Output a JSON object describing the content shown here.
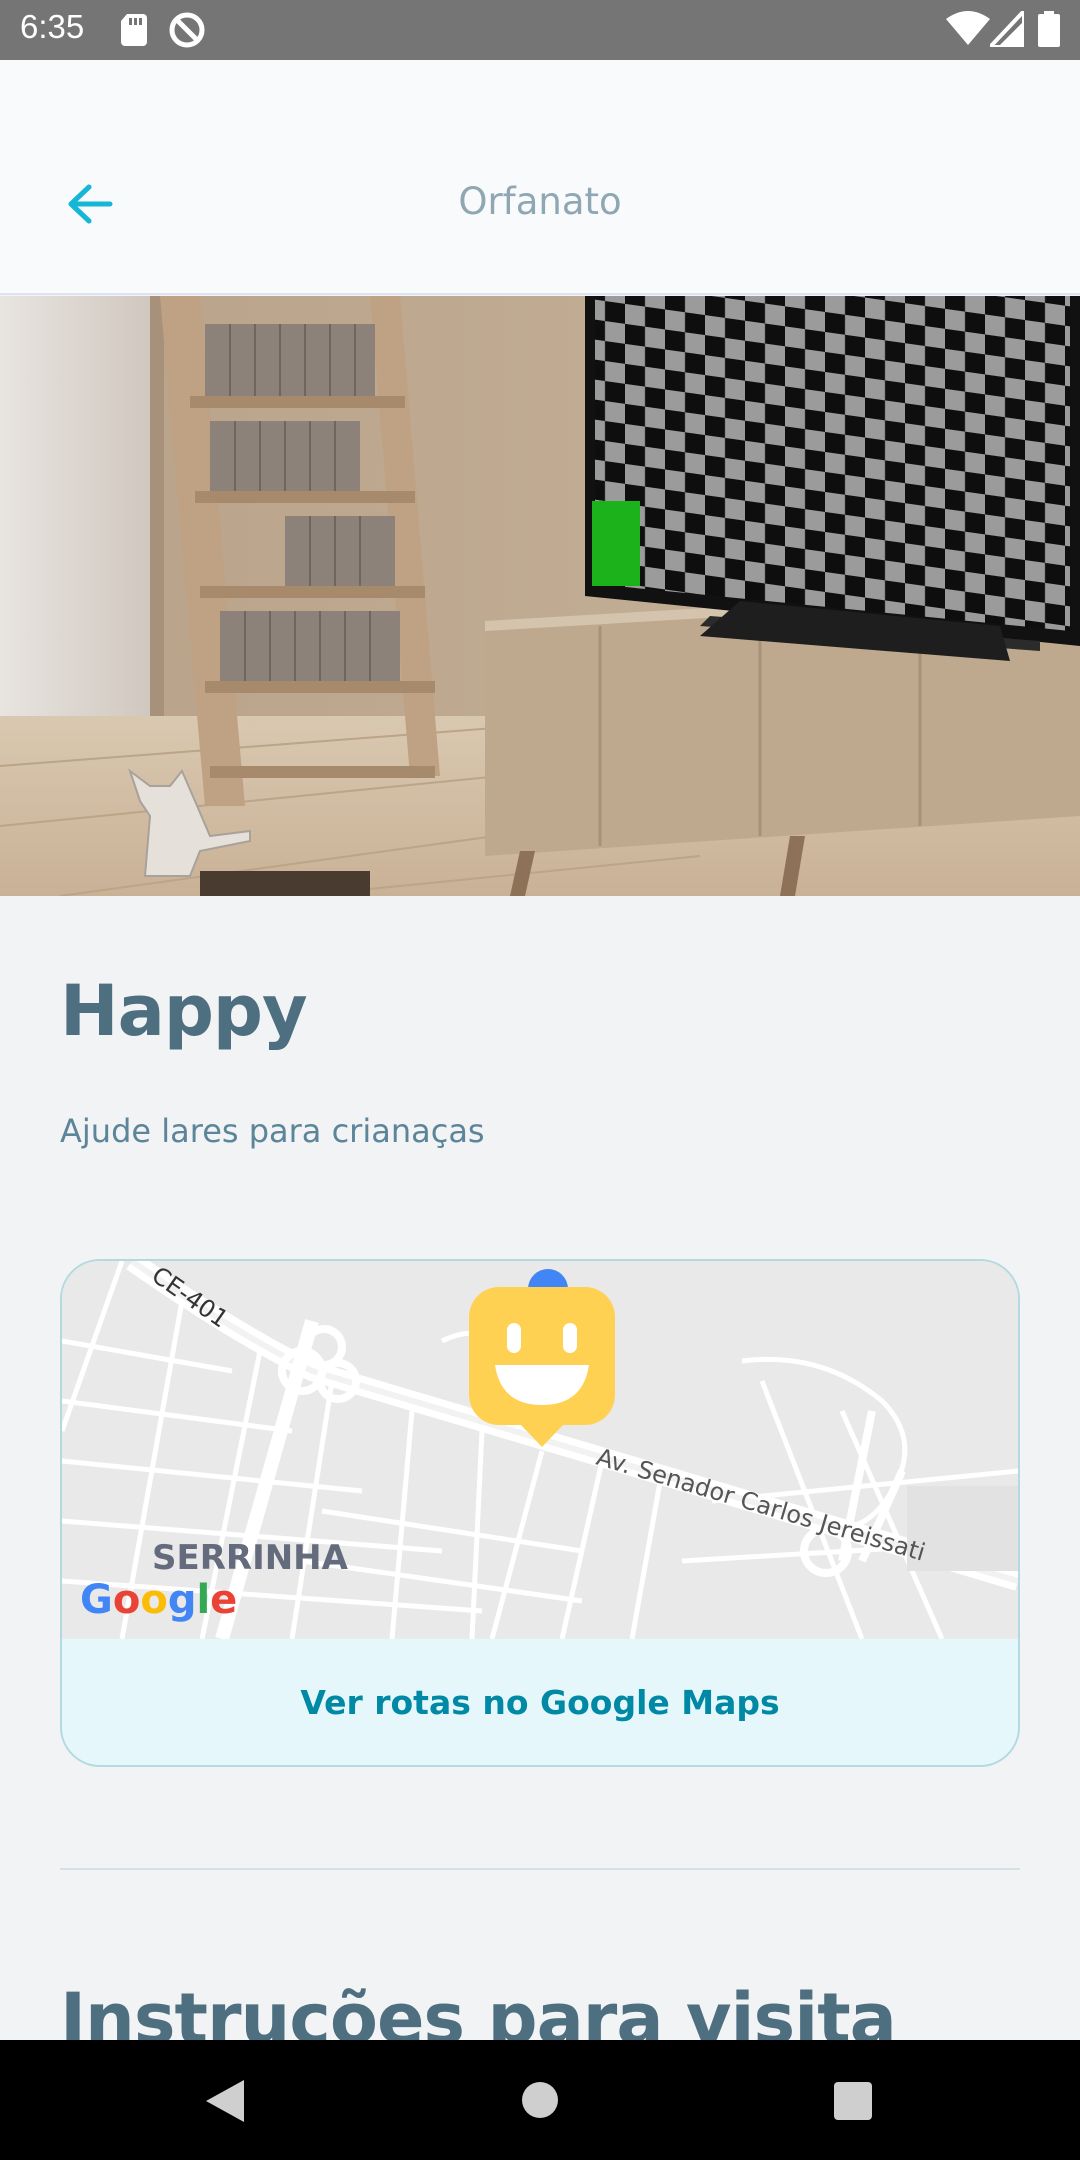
{
  "status_bar": {
    "time": "6:35",
    "icons": [
      "sd-card-icon",
      "do-not-disturb-icon",
      "wifi-icon",
      "cellular-signal-icon",
      "battery-icon"
    ]
  },
  "header": {
    "title": "Orfanato",
    "back_icon": "arrow-left-icon",
    "accent_color": "#15b6d6"
  },
  "hero": {
    "image": "room-interior-photo"
  },
  "place": {
    "name": "Happy",
    "about": "Ajude lares para crianaças"
  },
  "map": {
    "labels": {
      "road": "CE-401",
      "avenue": "Av. Senador Carlos Jereissati",
      "district": "SERRINHA"
    },
    "marker_icon": "happy-face-marker-icon",
    "marker_color": "#ffd152",
    "provider_logo": "Google",
    "directions_label": "Ver rotas no Google Maps"
  },
  "section": {
    "title": "Instruções para visita"
  },
  "nav_bar": {
    "icons": [
      "nav-back-icon",
      "nav-home-icon",
      "nav-recents-icon"
    ]
  }
}
